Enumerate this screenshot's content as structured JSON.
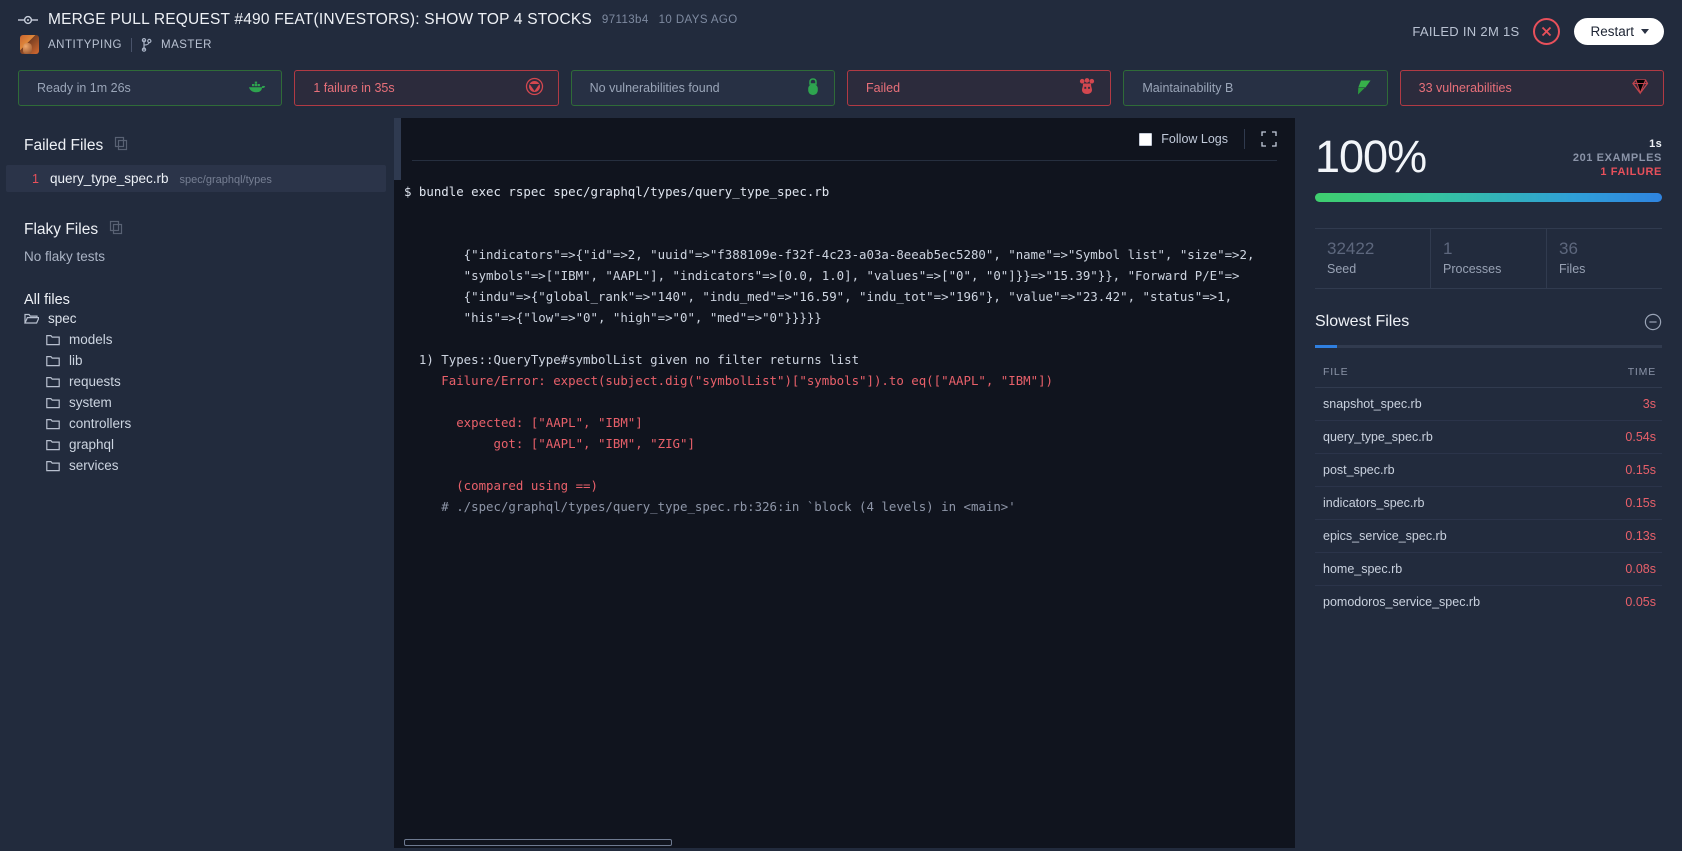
{
  "header": {
    "commit_icon": "commit-node-icon",
    "pr_title": "MERGE PULL REQUEST #490 FEAT(INVESTORS): SHOW TOP 4 STOCKS",
    "commit_sha": "97113b4",
    "commit_age": "10 DAYS AGO",
    "repo": "ANTITYPING",
    "branch": "MASTER",
    "status_text": "FAILED IN 2m 1s",
    "restart_label": "Restart"
  },
  "cards": [
    {
      "label": "Ready in 1m 26s",
      "state": "ok",
      "icon": "docker-whale-icon"
    },
    {
      "label": "1 failure in 35s",
      "state": "bad",
      "icon": "rspec-icon"
    },
    {
      "label": "No vulnerabilities found",
      "state": "ok",
      "icon": "lock-shield-icon"
    },
    {
      "label": "Failed",
      "state": "bad",
      "icon": "jest-icon"
    },
    {
      "label": "Maintainability B",
      "state": "ok",
      "icon": "diamond-icon"
    },
    {
      "label": "33 vulnerabilities",
      "state": "bad",
      "icon": "ruby-gem-icon"
    }
  ],
  "sidebar": {
    "failed_files_title": "Failed Files",
    "failed_files": [
      {
        "count": "1",
        "name": "query_type_spec.rb",
        "path": "spec/graphql/types"
      }
    ],
    "flaky_files_title": "Flaky Files",
    "flaky_empty": "No flaky tests",
    "all_files_title": "All files",
    "root": "spec",
    "folders": [
      "models",
      "lib",
      "requests",
      "system",
      "controllers",
      "graphql",
      "services"
    ]
  },
  "console": {
    "follow_logs_label": "Follow Logs",
    "follow_logs_checked": false,
    "expand_icon": "expand-fullscreen-icon",
    "lines": [
      {
        "t": "cmd",
        "s": "$ bundle exec rspec spec/graphql/types/query_type_spec.rb"
      },
      {
        "t": "blank",
        "s": ""
      },
      {
        "t": "blank",
        "s": ""
      },
      {
        "t": "plain",
        "s": "        {\"indicators\"=>{\"id\"=>2, \"uuid\"=>\"f388109e-f32f-4c23-a03a-8eeab5ec5280\", \"name\"=>\"Symbol list\", \"size\"=>2,"
      },
      {
        "t": "plain",
        "s": "        \"symbols\"=>[\"IBM\", \"AAPL\"], \"indicators\"=>[0.0, 1.0], \"values\"=>[\"0\", \"0\"]}}=>\"15.39\"}}, \"Forward P/E\"=>"
      },
      {
        "t": "plain",
        "s": "        {\"indu\"=>{\"global_rank\"=>\"140\", \"indu_med\"=>\"16.59\", \"indu_tot\"=>\"196\"}, \"value\"=>\"23.42\", \"status\"=>1,"
      },
      {
        "t": "plain",
        "s": "        \"his\"=>{\"low\"=>\"0\", \"high\"=>\"0\", \"med\"=>\"0\"}}}}}"
      },
      {
        "t": "blank",
        "s": ""
      },
      {
        "t": "plain",
        "s": "  1) Types::QueryType#symbolList given no filter returns list"
      },
      {
        "t": "red",
        "s": "     Failure/Error: expect(subject.dig(\"symbolList\")[\"symbols\"]).to eq([\"AAPL\", \"IBM\"])"
      },
      {
        "t": "blank",
        "s": ""
      },
      {
        "t": "red",
        "s": "       expected: [\"AAPL\", \"IBM\"]"
      },
      {
        "t": "red",
        "s": "            got: [\"AAPL\", \"IBM\", \"ZIG\"]"
      },
      {
        "t": "blank",
        "s": ""
      },
      {
        "t": "red",
        "s": "       (compared using ==)"
      },
      {
        "t": "comment",
        "s": "     # ./spec/graphql/types/query_type_spec.rb:326:in `block (4 levels) in <main>'"
      }
    ]
  },
  "summary": {
    "percent": "100%",
    "time": "1s",
    "examples": "201 EXAMPLES",
    "failures": "1 FAILURE",
    "stats": [
      {
        "value": "32422",
        "label": "Seed"
      },
      {
        "value": "1",
        "label": "Processes"
      },
      {
        "value": "36",
        "label": "Files"
      }
    ],
    "slowest_title": "Slowest Files",
    "collapse_icon": "minus-circle-icon",
    "columns": {
      "file": "FILE",
      "time": "TIME"
    },
    "rows": [
      {
        "file": "snapshot_spec.rb",
        "time": "3s"
      },
      {
        "file": "query_type_spec.rb",
        "time": "0.54s"
      },
      {
        "file": "post_spec.rb",
        "time": "0.15s"
      },
      {
        "file": "indicators_spec.rb",
        "time": "0.15s"
      },
      {
        "file": "epics_service_spec.rb",
        "time": "0.13s"
      },
      {
        "file": "home_spec.rb",
        "time": "0.08s"
      },
      {
        "file": "pomodoros_service_spec.rb",
        "time": "0.05s"
      }
    ]
  }
}
